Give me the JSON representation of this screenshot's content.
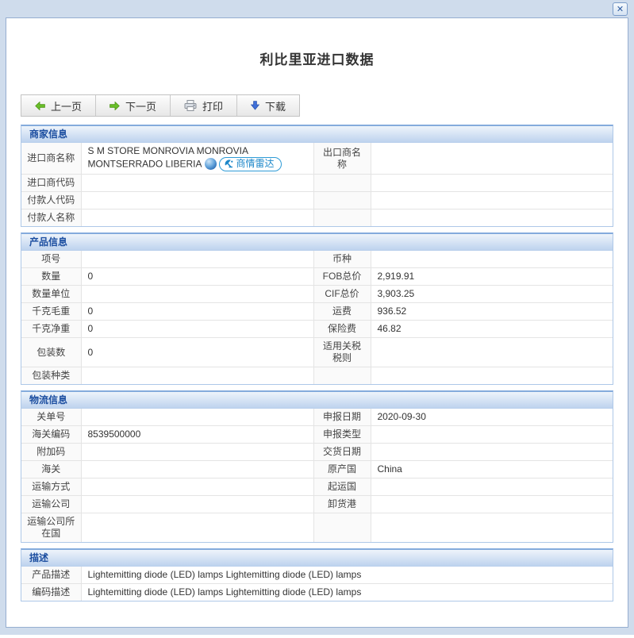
{
  "window": {
    "close": "✕"
  },
  "title": "利比里亚进口数据",
  "toolbar": {
    "prev": "上一页",
    "next": "下一页",
    "print": "打印",
    "download": "下载"
  },
  "sections": {
    "merchant": {
      "title": "商家信息",
      "importer": {
        "label": "进口商名称",
        "name": "S M STORE MONROVIA MONROVIA MONTSERRADO LIBERIA",
        "radar_badge": "商情雷达"
      },
      "exporter_label": "出口商名称",
      "exporter_value": "",
      "rows": [
        {
          "l1": "进口商代码",
          "v1": "",
          "l2": "",
          "v2": ""
        },
        {
          "l1": "付款人代码",
          "v1": "",
          "l2": "",
          "v2": ""
        },
        {
          "l1": "付款人名称",
          "v1": "",
          "l2": "",
          "v2": ""
        }
      ]
    },
    "product": {
      "title": "产品信息",
      "rows": [
        {
          "l1": "项号",
          "v1": "",
          "l2": "币种",
          "v2": ""
        },
        {
          "l1": "数量",
          "v1": "0",
          "l2": "FOB总价",
          "v2": "2,919.91"
        },
        {
          "l1": "数量单位",
          "v1": "",
          "l2": "CIF总价",
          "v2": "3,903.25"
        },
        {
          "l1": "千克毛重",
          "v1": "0",
          "l2": "运费",
          "v2": "936.52"
        },
        {
          "l1": "千克净重",
          "v1": "0",
          "l2": "保险费",
          "v2": "46.82"
        },
        {
          "l1": "包装数",
          "v1": "0",
          "l2": "适用关税税则",
          "v2": ""
        },
        {
          "l1": "包装种类",
          "v1": "",
          "l2": "",
          "v2": ""
        }
      ]
    },
    "logistics": {
      "title": "物流信息",
      "rows": [
        {
          "l1": "关单号",
          "v1": "",
          "l2": "申报日期",
          "v2": "2020-09-30"
        },
        {
          "l1": "海关编码",
          "v1": "8539500000",
          "l2": "申报类型",
          "v2": ""
        },
        {
          "l1": "附加码",
          "v1": "",
          "l2": "交货日期",
          "v2": ""
        },
        {
          "l1": "海关",
          "v1": "",
          "l2": "原产国",
          "v2": "China"
        },
        {
          "l1": "运输方式",
          "v1": "",
          "l2": "起运国",
          "v2": ""
        },
        {
          "l1": "运输公司",
          "v1": "",
          "l2": "卸货港",
          "v2": ""
        },
        {
          "l1": "运输公司所在国",
          "v1": "",
          "l2": "",
          "v2": ""
        }
      ]
    },
    "description": {
      "title": "描述",
      "rows": [
        {
          "label": "产品描述",
          "value": "Lightemitting diode (LED) lamps Lightemitting diode (LED) lamps"
        },
        {
          "label": "编码描述",
          "value": "Lightemitting diode (LED) lamps Lightemitting diode (LED) lamps"
        }
      ]
    }
  },
  "icons": {
    "close": "x-mark",
    "prev": "green-left-arrow",
    "next": "green-right-arrow",
    "print": "printer",
    "download": "blue-down-arrow",
    "globe": "blue-globe",
    "radar": "satellite-dish"
  },
  "colors": {
    "frame": "#cfdcec",
    "section_border": "#aec8e8",
    "section_header_text": "#1c4ea0",
    "radar_blue": "#1d87c9",
    "arrow_green": "#6abf2a",
    "arrow_blue": "#3f6fd8"
  }
}
